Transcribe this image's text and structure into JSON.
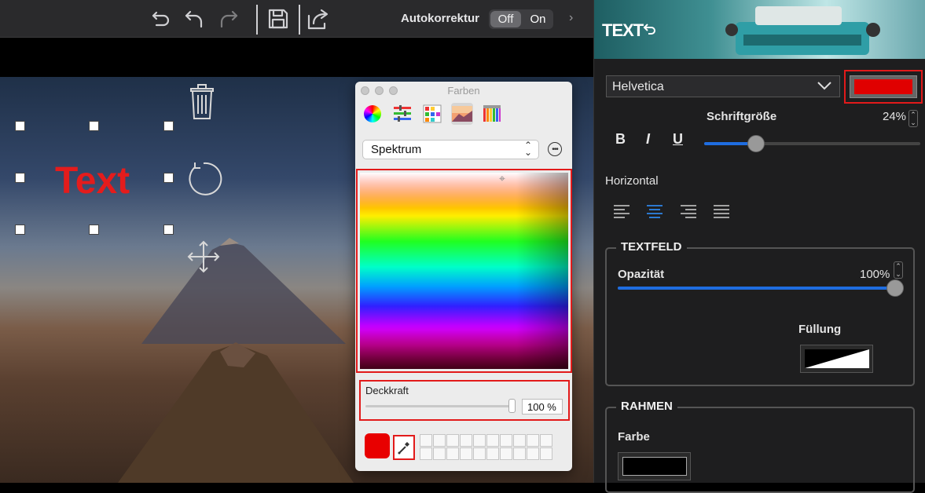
{
  "toolbar": {
    "autokorrektur_label": "Autokorrektur",
    "toggle_off": "Off",
    "toggle_on": "On",
    "icons": [
      "undo-all-icon",
      "undo-icon",
      "redo-icon",
      "save-icon",
      "share-icon",
      "chevron-right-icon"
    ]
  },
  "canvas": {
    "text_object": "Text",
    "text_color": "#e41c1c",
    "icons": [
      "trash-icon",
      "rotate-icon",
      "move-icon"
    ]
  },
  "color_panel": {
    "title": "Farben",
    "mode": "Spektrum",
    "opacity_label": "Deckkraft",
    "opacity_value": "100 %",
    "current_color": "#e80000",
    "mode_icons": [
      "color-wheel-icon",
      "color-sliders-icon",
      "color-palettes-icon",
      "image-palettes-icon",
      "pencils-icon"
    ]
  },
  "right_panel": {
    "title": "TEXT",
    "font": "Helvetica",
    "text_color": "#e00000",
    "font_size_label": "Schriftgröße",
    "font_size_value": "24%",
    "font_size_fraction": 0.24,
    "bold": "B",
    "italic": "I",
    "underline": "U",
    "horizontal_label": "Horizontal",
    "alignment_options": [
      "left",
      "center",
      "right",
      "justify"
    ],
    "alignment_selected": "center",
    "textfeld": {
      "title": "TEXTFELD",
      "opacity_label": "Opazität",
      "opacity_value": "100%",
      "opacity_fraction": 1.0,
      "fill_label": "Füllung"
    },
    "rahmen": {
      "title": "RAHMEN",
      "color_label": "Farbe",
      "color": "#000000"
    }
  },
  "colors": {
    "highlight": "#e21a1a",
    "accent": "#1f6de0"
  }
}
